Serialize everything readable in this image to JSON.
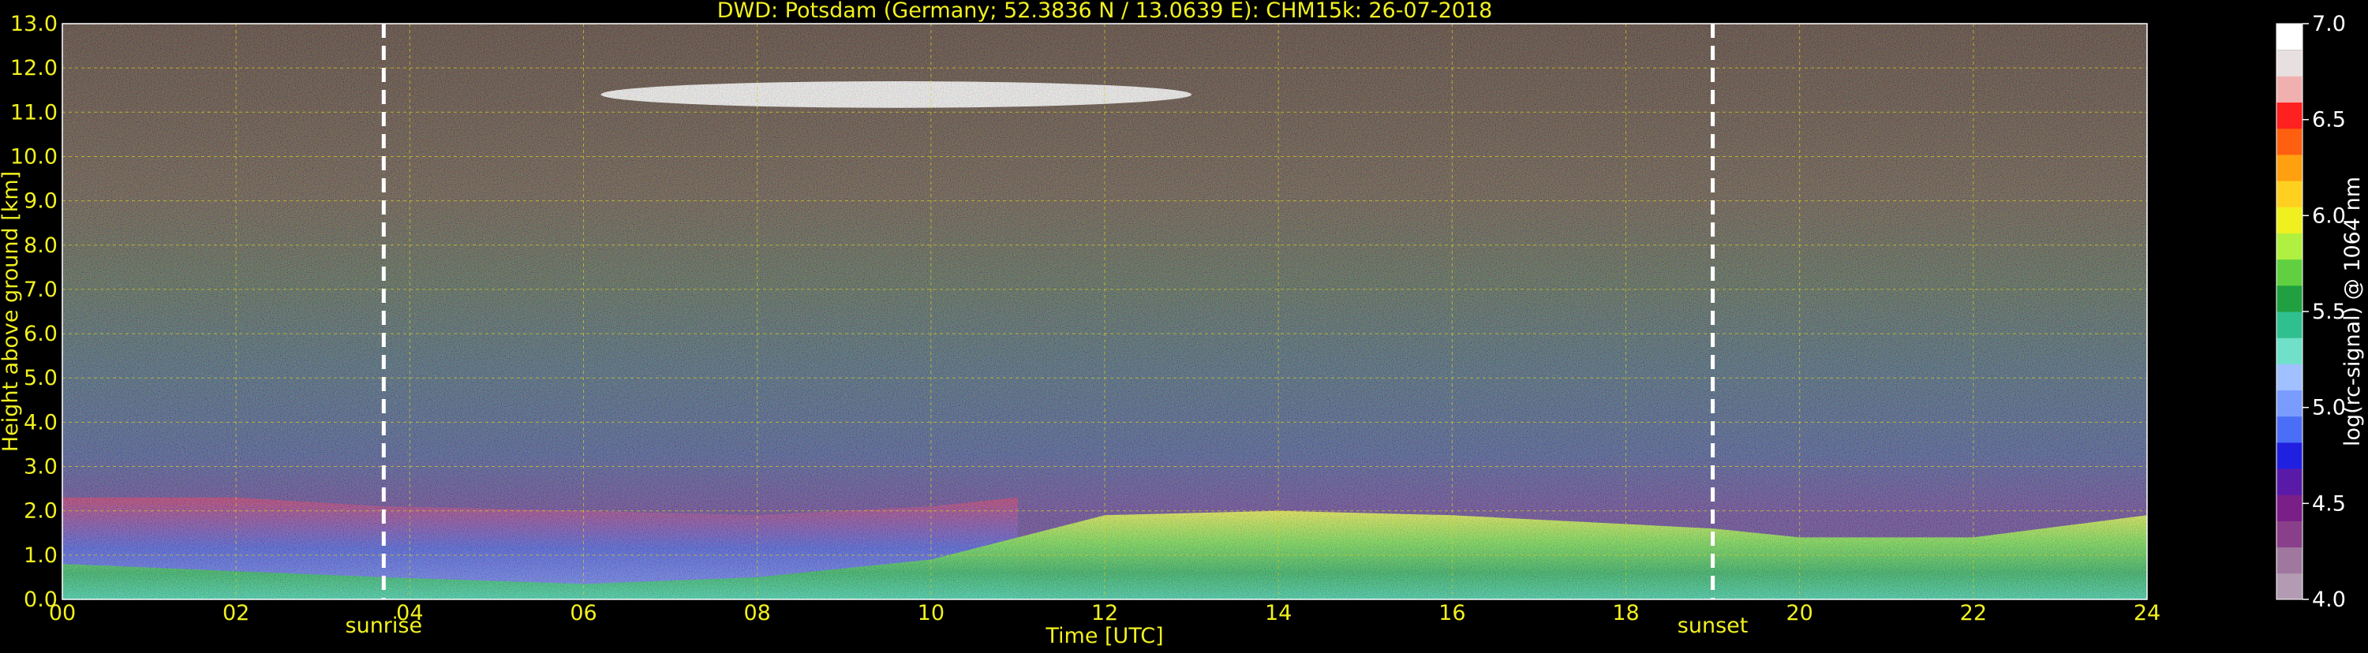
{
  "chart_data": {
    "type": "heatmap",
    "title": "DWD: Potsdam (Germany; 52.3836 N / 13.0639 E):    CHM15k: 26-07-2018",
    "xlabel": "Time [UTC]",
    "ylabel": "Height above ground [km]",
    "xlim": [
      0,
      24
    ],
    "ylim": [
      0,
      13
    ],
    "x_ticks": [
      "00",
      "02",
      "04",
      "06",
      "08",
      "10",
      "12",
      "14",
      "16",
      "18",
      "20",
      "22",
      "24"
    ],
    "y_ticks": [
      "0.0",
      "1.0",
      "2.0",
      "3.0",
      "4.0",
      "5.0",
      "6.0",
      "7.0",
      "8.0",
      "9.0",
      "10.0",
      "11.0",
      "12.0",
      "13.0"
    ],
    "grid": true,
    "sunrise": {
      "label": "sunrise",
      "time": 3.7
    },
    "sunset": {
      "label": "sunset",
      "time": 19.0
    },
    "colorbar": {
      "label": "log(rc-signal) @ 1064 nm",
      "range": [
        4.0,
        7.0
      ],
      "ticks": [
        "4.0",
        "4.5",
        "5.0",
        "5.5",
        "6.0",
        "6.5",
        "7.0"
      ],
      "colors": [
        "#b39bb3",
        "#a0789f",
        "#8a3f8a",
        "#7a1e88",
        "#5a1aa8",
        "#2020e0",
        "#4a6ef5",
        "#7a9cff",
        "#a0c0ff",
        "#70e0c8",
        "#30c090",
        "#20a040",
        "#60d040",
        "#b0f040",
        "#f0f020",
        "#ffd020",
        "#ffa010",
        "#ff6010",
        "#ff2020",
        "#f0b0b0",
        "#e8e0e0",
        "#ffffff"
      ]
    },
    "layers": [
      {
        "name": "near-surface aerosol",
        "t": [
          0,
          3.7,
          6,
          8,
          10,
          12,
          14,
          16,
          18,
          19,
          20,
          22,
          24
        ],
        "top_km": [
          0.8,
          0.5,
          0.35,
          0.5,
          0.9,
          1.9,
          2.0,
          1.9,
          1.7,
          1.6,
          1.4,
          1.4,
          1.9
        ]
      },
      {
        "name": "residual layer",
        "t": [
          0,
          2,
          3.7,
          6,
          8,
          10,
          11
        ],
        "top_km": [
          2.3,
          2.3,
          2.1,
          2.0,
          1.9,
          2.1,
          2.3
        ]
      },
      {
        "name": "cirrus cloud",
        "t": [
          6.2,
          13
        ],
        "base_km": 11.1,
        "top_km": 11.7
      }
    ]
  }
}
